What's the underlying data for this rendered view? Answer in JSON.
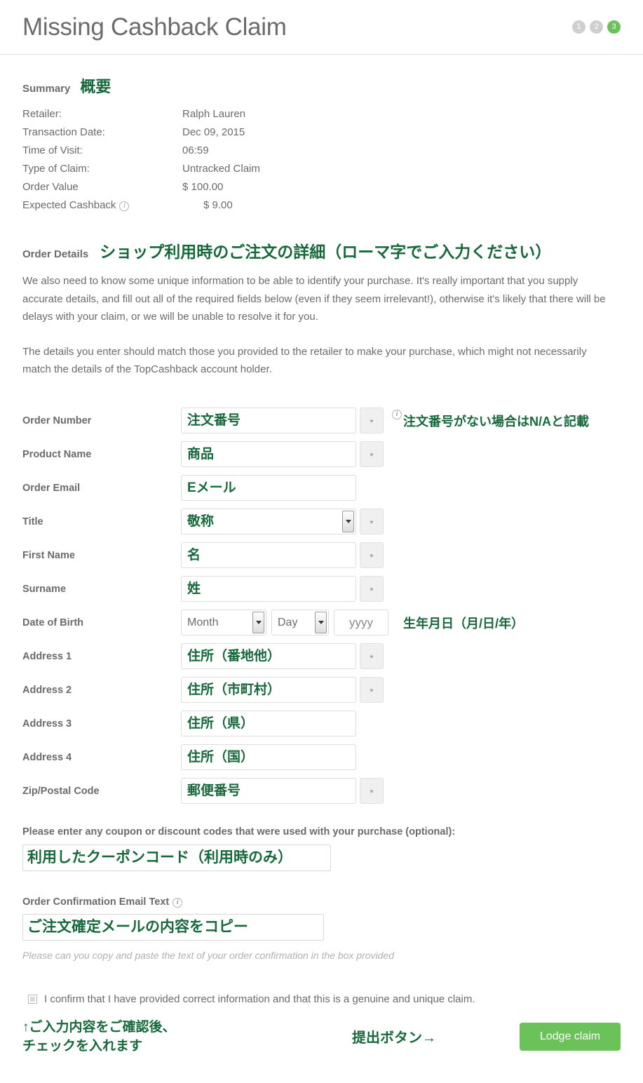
{
  "header": {
    "title": "Missing Cashback Claim",
    "steps": [
      {
        "label": "1",
        "active": false
      },
      {
        "label": "2",
        "active": false
      },
      {
        "label": "3",
        "active": true
      }
    ]
  },
  "summary": {
    "heading_en": "Summary",
    "heading_jp": "概要",
    "rows": [
      {
        "label": "Retailer:",
        "value": "Ralph Lauren"
      },
      {
        "label": "Transaction Date:",
        "value": "Dec 09, 2015"
      },
      {
        "label": "Time of Visit:",
        "value": "06:59"
      },
      {
        "label": "Type of Claim:",
        "value": "Untracked Claim"
      },
      {
        "label": "Order Value",
        "value": "$ 100.00"
      },
      {
        "label": "Expected Cashback",
        "value": "$ 9.00",
        "info": true
      }
    ]
  },
  "order_details": {
    "heading_en": "Order Details",
    "heading_jp": "ショップ利用時のご注文の詳細（ローマ字でご入力ください）",
    "paragraph1": "We also need to know some unique information to be able to identify your purchase. It's really important that you supply accurate details, and fill out all of the required fields below (even if they seem irrelevant!), otherwise it's likely that there will be delays with your claim, or we will be unable to resolve it for you.",
    "paragraph2": "The details you enter should match those you provided to the retailer to make your purchase, which might not necessarily match the details of the TopCashback account holder."
  },
  "form": {
    "required_mark": "*",
    "order_number": {
      "label": "Order Number",
      "placeholder": "注文番号",
      "annotation": "注文番号がない場合はN/Aと記載"
    },
    "product_name": {
      "label": "Product Name",
      "placeholder": "商品"
    },
    "order_email": {
      "label": "Order Email",
      "placeholder": "Eメール"
    },
    "title": {
      "label": "Title",
      "selected": "敬称"
    },
    "first_name": {
      "label": "First Name",
      "placeholder": "名"
    },
    "surname": {
      "label": "Surname",
      "placeholder": "姓"
    },
    "date_of_birth": {
      "label": "Date of Birth",
      "month": "Month",
      "day": "Day",
      "year_placeholder": "yyyy",
      "annotation": "生年月日（月/日/年）"
    },
    "address1": {
      "label": "Address 1",
      "placeholder": "住所（番地他）"
    },
    "address2": {
      "label": "Address 2",
      "placeholder": "住所（市町村）"
    },
    "address3": {
      "label": "Address 3",
      "placeholder": "住所（県）"
    },
    "address4": {
      "label": "Address 4",
      "placeholder": "住所（国）"
    },
    "zip": {
      "label": "Zip/Postal Code",
      "placeholder": "郵便番号"
    }
  },
  "coupon": {
    "label": "Please enter any coupon or discount codes that were used with your purchase (optional):",
    "placeholder": "利用したクーポンコード（利用時のみ）"
  },
  "confirmation_email": {
    "label": "Order Confirmation Email Text",
    "placeholder": "ご注文確定メールの内容をコピー",
    "hint": "Please can you copy and paste the text of your order confirmation in the box provided"
  },
  "footer": {
    "confirm_text": "I confirm that I have provided correct information and that this is a genuine and unique claim.",
    "annotation_check": "↑ご入力内容をご確認後、\n  チェックを入れます",
    "annotation_submit": "提出ボタン→",
    "lodge_button": "Lodge claim"
  },
  "colors": {
    "accent_green": "#17693b",
    "button_green": "#6ac259",
    "text_grey": "#6b6b6b"
  }
}
